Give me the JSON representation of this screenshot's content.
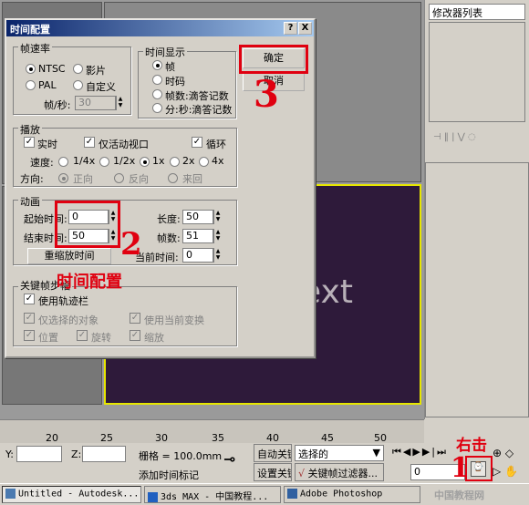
{
  "background": {
    "viewport_text": "ext",
    "command_panel": {
      "modifier_list": "修改器列表"
    },
    "timeline_ticks": [
      "20",
      "25",
      "30",
      "35",
      "40",
      "45",
      "50"
    ],
    "status": {
      "y_label": "Y:",
      "z_label": "Z:",
      "grid_label": "栅格 = 100.0mm",
      "add_time_tag": "添加时间标记",
      "auto_key": "自动关键帧",
      "set_key": "设置关键帧",
      "selected_option": "选择的",
      "key_filter": "关键帧过滤器...",
      "frame_value": "0"
    },
    "taskbar": {
      "items": [
        "Untitled - Autodesk...",
        "3ds MAX - 中国教程...",
        "Adobe Photoshop"
      ],
      "watermark": "中国教程网"
    }
  },
  "dialog": {
    "title": "时间配置",
    "help_btn": "?",
    "close_btn": "X",
    "frame_rate": {
      "label": "帧速率",
      "options": [
        "NTSC",
        "影片",
        "PAL",
        "自定义"
      ],
      "selected": "NTSC",
      "fps_label": "帧/秒:",
      "fps_value": "30"
    },
    "time_display": {
      "label": "时间显示",
      "options": [
        "帧",
        "时码",
        "帧数:滴答记数",
        "分:秒:滴答记数"
      ],
      "selected": "帧"
    },
    "ok_label": "确定",
    "cancel_label": "取消",
    "playback": {
      "label": "播放",
      "realtime": "实时",
      "active_only": "仅活动视口",
      "loop": "循环",
      "speed_label": "速度:",
      "speeds": [
        "1/4x",
        "1/2x",
        "1x",
        "2x",
        "4x"
      ],
      "speed_selected": "1x",
      "direction_label": "方向:",
      "directions": [
        "正向",
        "反向",
        "来回"
      ],
      "direction_selected": "正向"
    },
    "animation": {
      "label": "动画",
      "start_label": "起始时间:",
      "start_value": "0",
      "end_label": "结束时间:",
      "end_value": "50",
      "length_label": "长度:",
      "length_value": "50",
      "frames_label": "帧数:",
      "frames_value": "51",
      "rescale_btn": "重缩放时间",
      "current_label": "当前时间:",
      "current_value": "0"
    },
    "key_steps": {
      "label": "关键帧步幅",
      "use_trackbar": "使用轨迹栏",
      "selected_only": "仅选择的对象",
      "use_current": "使用当前变换",
      "position": "位置",
      "rotation": "旋转",
      "scale": "缩放"
    }
  },
  "annotations": {
    "num3": "3",
    "num2": "2",
    "num1": "1",
    "time_config": "时间配置",
    "right_click": "右击"
  },
  "colors": {
    "highlight": "#e00010",
    "title_bar": "#0a246a"
  }
}
